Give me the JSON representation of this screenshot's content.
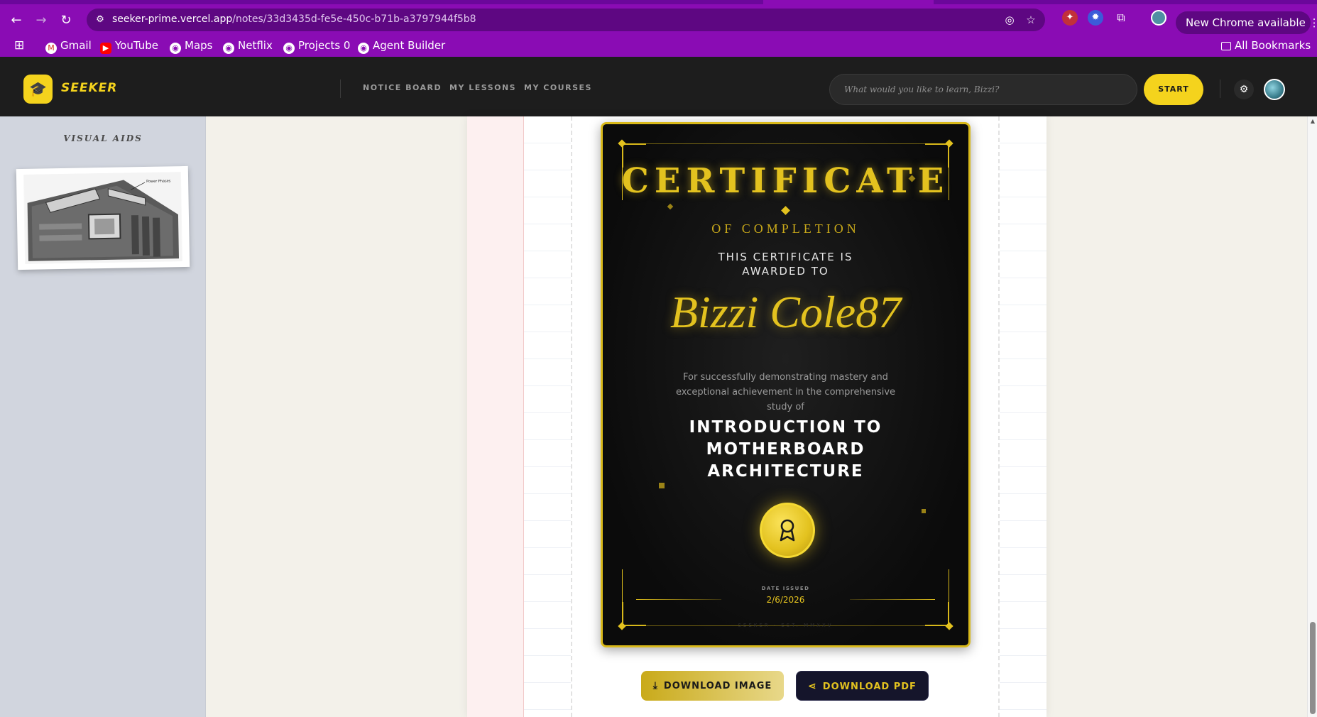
{
  "browser": {
    "url_host": "seeker-prime.vercel.app",
    "url_path": "/notes/33d3435d-fe5e-450c-b71b-a3797944f5b8",
    "new_chrome_label": "New Chrome available",
    "new_chrome_menu": "⋮",
    "bookmarks": [
      {
        "label": "Gmail",
        "icon": "gmail-icon"
      },
      {
        "label": "YouTube",
        "icon": "youtube-icon"
      },
      {
        "label": "Maps",
        "icon": "globe-icon"
      },
      {
        "label": "Netflix",
        "icon": "globe-icon"
      },
      {
        "label": "Projects 0",
        "icon": "globe-icon"
      },
      {
        "label": "Agent Builder",
        "icon": "globe-icon"
      }
    ],
    "all_bookmarks": "All Bookmarks"
  },
  "app": {
    "brand": "SEEKER",
    "nav": [
      "NOTICE BOARD",
      "MY LESSONS",
      "MY COURSES"
    ],
    "search_placeholder": "What would you like to learn, Bizzi?",
    "start_label": "START"
  },
  "sidebar": {
    "title": "VISUAL AIDS",
    "aid_caption": "Power Phases"
  },
  "certificate": {
    "title": "CERTIFICATE",
    "subtitle": "OF COMPLETION",
    "awarded_line1": "THIS CERTIFICATE IS",
    "awarded_line2": "AWARDED TO",
    "recipient": "Bizzi Cole87",
    "description": "For successfully demonstrating mastery and exceptional achievement in the comprehensive study of",
    "course_line1": "INTRODUCTION TO",
    "course_line2": "MOTHERBOARD",
    "course_line3": "ARCHITECTURE",
    "date_label": "DATE ISSUED",
    "date_value": "2/6/2026",
    "footer": "SEEKER · EST. MMXXV",
    "accent_color": "#e3c21f"
  },
  "actions": {
    "download_image": "DOWNLOAD IMAGE",
    "download_pdf": "DOWNLOAD PDF"
  }
}
